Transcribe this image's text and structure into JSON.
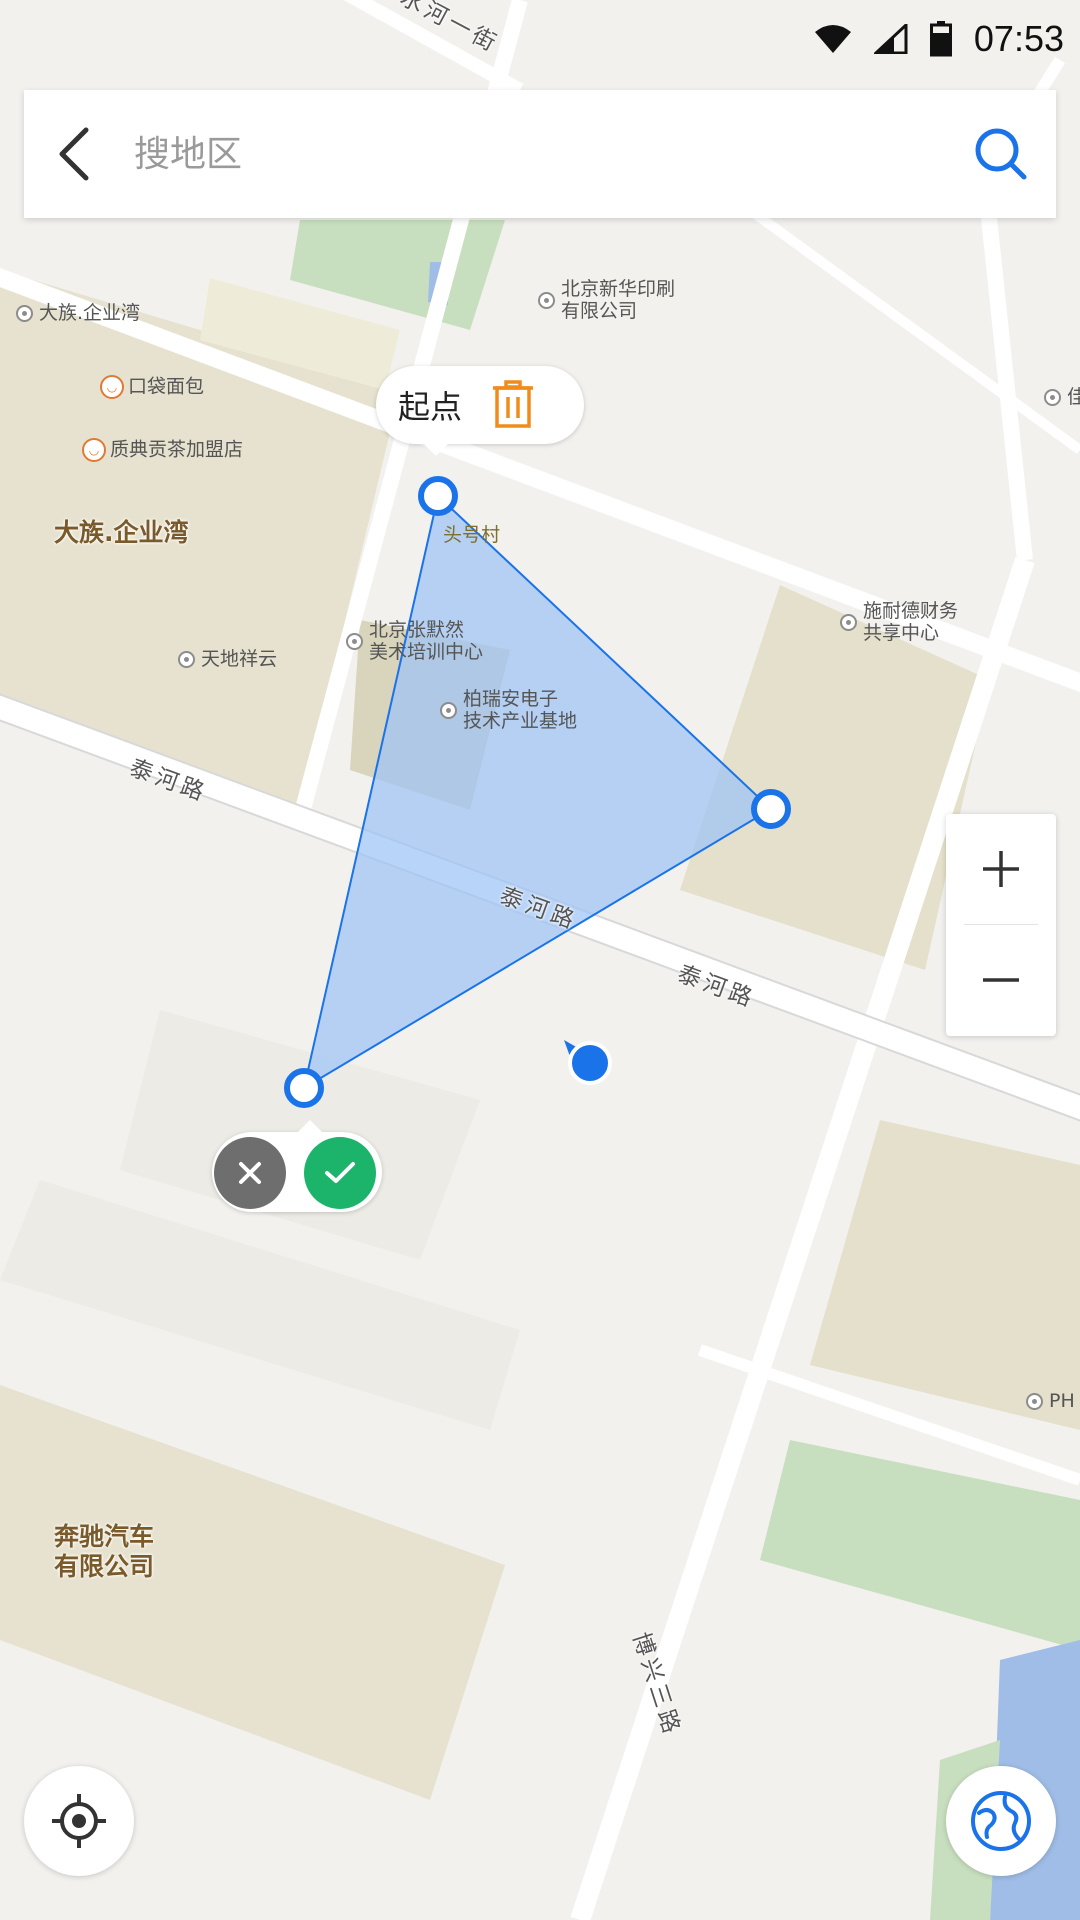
{
  "status_bar": {
    "time": "07:53",
    "icons": [
      "wifi-icon",
      "cell-signal-icon",
      "battery-icon"
    ]
  },
  "search": {
    "placeholder": "搜地区",
    "value": ""
  },
  "drawing": {
    "start_label": "起点",
    "accent_color": "#1a73e8",
    "fill_color": "#9cc3f5",
    "confirm_color": "#1bb46a",
    "cancel_color": "#6e6e6e",
    "delete_color": "#f08c1b"
  },
  "map": {
    "districts": [
      "大族.企业湾",
      "奔驰汽车\n有限公司"
    ],
    "villages": [
      "头号村"
    ],
    "roads": [
      "泰河路",
      "泰河路",
      "泰河路",
      "博兴三路",
      "凉水河一街"
    ],
    "pois": [
      "大族.企业湾",
      "口袋面包",
      "质典贡茶加盟店",
      "北京新华印刷\n有限公司",
      "施耐德财务\n共享中心",
      "北京张默然\n美术培训中心",
      "柏瑞安电子\n技术产业基地",
      "天地祥云",
      "PH",
      "佳"
    ]
  },
  "controls": {
    "zoom_in_icon": "plus-icon",
    "zoom_out_icon": "minus-icon",
    "locate_icon": "locate-crosshair-icon",
    "layers_icon": "globe-icon"
  }
}
